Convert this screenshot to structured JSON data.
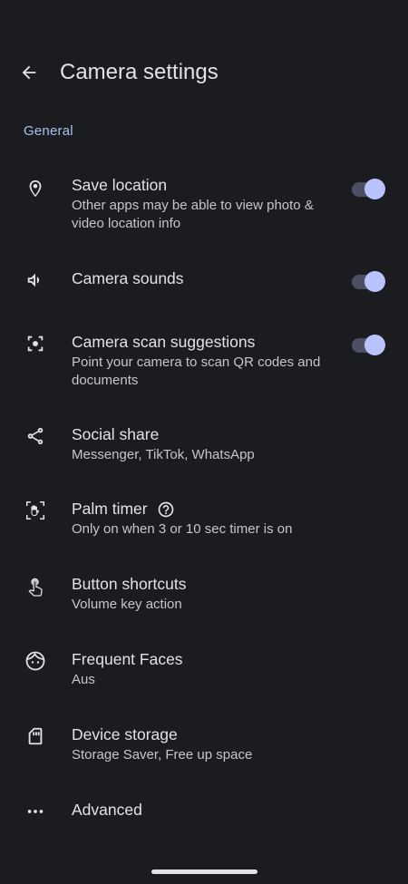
{
  "header": {
    "title": "Camera settings"
  },
  "section": {
    "label": "General"
  },
  "items": [
    {
      "primary": "Save location",
      "secondary": "Other apps may be able to view photo & video location info",
      "toggle_on": true,
      "icon": "location-pin-icon"
    },
    {
      "primary": "Camera sounds",
      "secondary": "",
      "toggle_on": true,
      "icon": "volume-icon"
    },
    {
      "primary": "Camera scan suggestions",
      "secondary": "Point your camera to scan QR codes and documents",
      "toggle_on": true,
      "icon": "scan-icon"
    },
    {
      "primary": "Social share",
      "secondary": "Messenger, TikTok, WhatsApp",
      "icon": "share-icon"
    },
    {
      "primary": "Palm timer",
      "secondary": "Only on when 3 or 10 sec timer is on",
      "icon": "palm-icon",
      "has_help": true
    },
    {
      "primary": "Button shortcuts",
      "secondary": "Volume key action",
      "icon": "touch-icon"
    },
    {
      "primary": "Frequent Faces",
      "secondary": "Aus",
      "icon": "face-icon"
    },
    {
      "primary": "Device storage",
      "secondary": "Storage Saver, Free up space",
      "icon": "sd-card-icon"
    },
    {
      "primary": "Advanced",
      "secondary": "",
      "icon": "more-horiz-icon"
    }
  ],
  "colors": {
    "background": "#1b1c20",
    "accent": "#a9c1f1",
    "toggle_thumb": "#b9c4ff",
    "toggle_track": "#4d5063"
  }
}
